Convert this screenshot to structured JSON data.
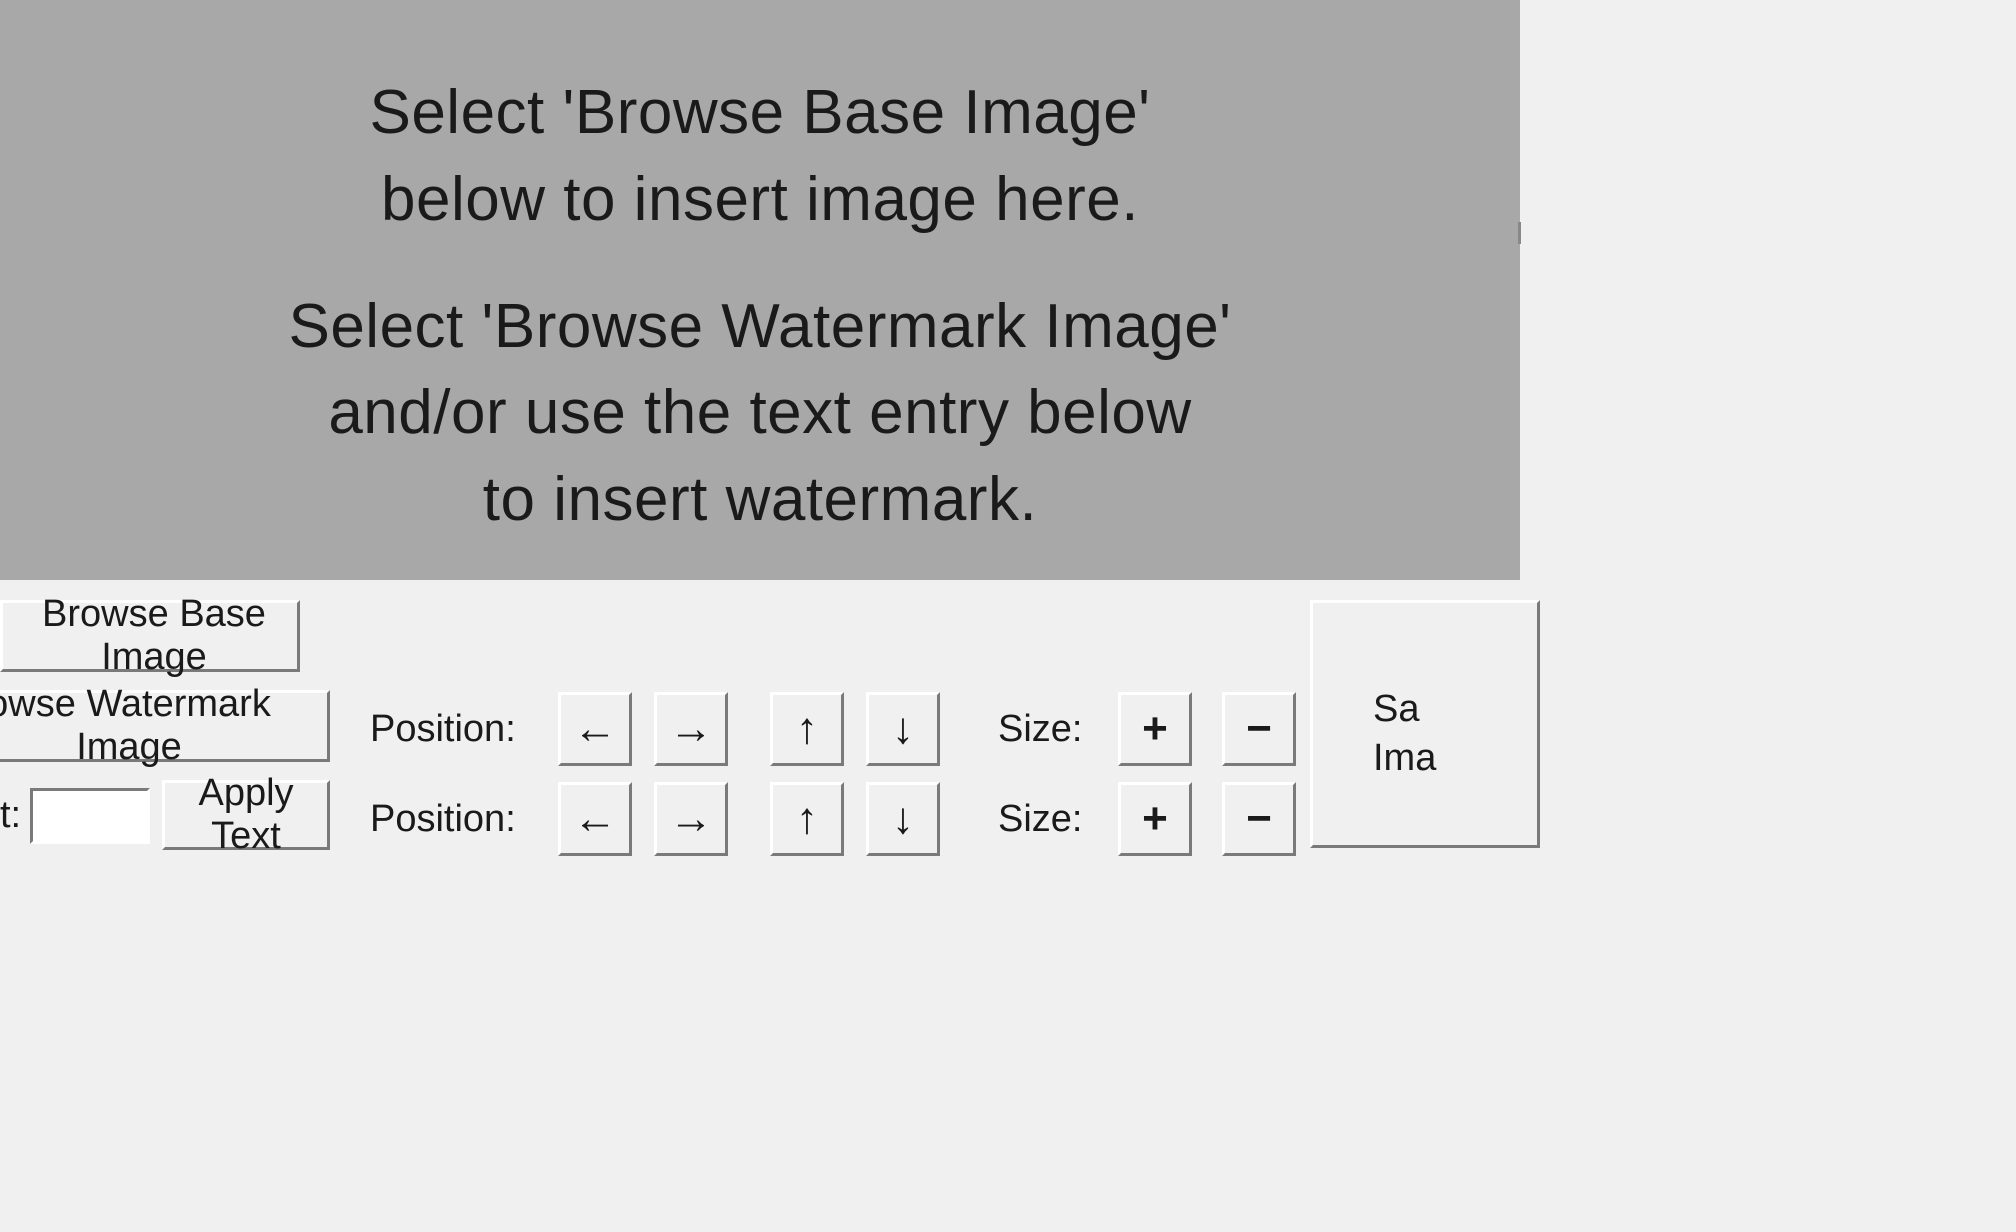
{
  "preview": {
    "msg1_line1": "Select 'Browse Base Image'",
    "msg1_line2": "below to insert image here.",
    "msg2_line1": "Select 'Browse Watermark Image'",
    "msg2_line2": "and/or use the text entry below",
    "msg2_line3": "to insert watermark."
  },
  "buttons": {
    "browse_base": "Browse Base Image",
    "browse_watermark": "owse Watermark Image",
    "apply_text": "Apply Text",
    "save_line1": "Sa",
    "save_line2": "Ima"
  },
  "labels": {
    "text_prefix": "t:",
    "position": "Position:",
    "size": "Size:"
  },
  "icons": {
    "left": "←",
    "right": "→",
    "up": "↑",
    "down": "↓",
    "plus": "+",
    "minus": "−"
  },
  "inputs": {
    "text_value": ""
  }
}
